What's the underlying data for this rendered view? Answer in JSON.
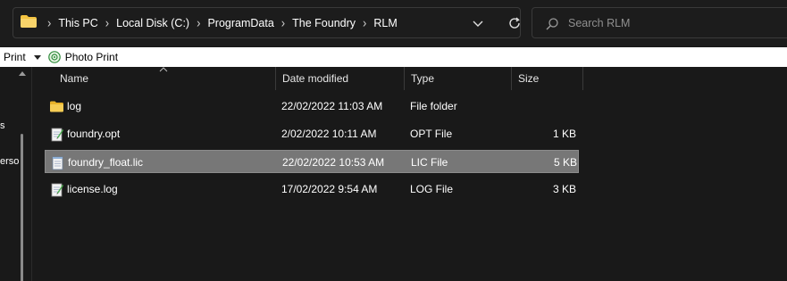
{
  "address_bar": {
    "crumbs": [
      "This PC",
      "Local Disk (C:)",
      "ProgramData",
      "The Foundry",
      "RLM"
    ]
  },
  "search": {
    "placeholder": "Search RLM"
  },
  "strip": {
    "print_label": "Print",
    "photo_print_label": "Photo Print"
  },
  "nav_pane": {
    "label1": "s",
    "label2": "erso"
  },
  "columns": {
    "name": "Name",
    "date": "Date modified",
    "type": "Type",
    "size": "Size"
  },
  "files": [
    {
      "name": "log",
      "date": "22/02/2022 11:03 AM",
      "type": "File folder",
      "size": "",
      "icon": "folder-icon",
      "selected": false
    },
    {
      "name": "foundry.opt",
      "date": "2/02/2022 10:11 AM",
      "type": "OPT File",
      "size": "1 KB",
      "icon": "notepad-file-icon",
      "selected": false
    },
    {
      "name": "foundry_float.lic",
      "date": "22/02/2022 10:53 AM",
      "type": "LIC File",
      "size": "5 KB",
      "icon": "text-file-icon",
      "selected": true
    },
    {
      "name": "license.log",
      "date": "17/02/2022 9:54 AM",
      "type": "LOG File",
      "size": "3 KB",
      "icon": "notepad-file-icon",
      "selected": false
    }
  ],
  "colors": {
    "background": "#191919",
    "selection": "#777777",
    "folder": "#f3c340"
  }
}
